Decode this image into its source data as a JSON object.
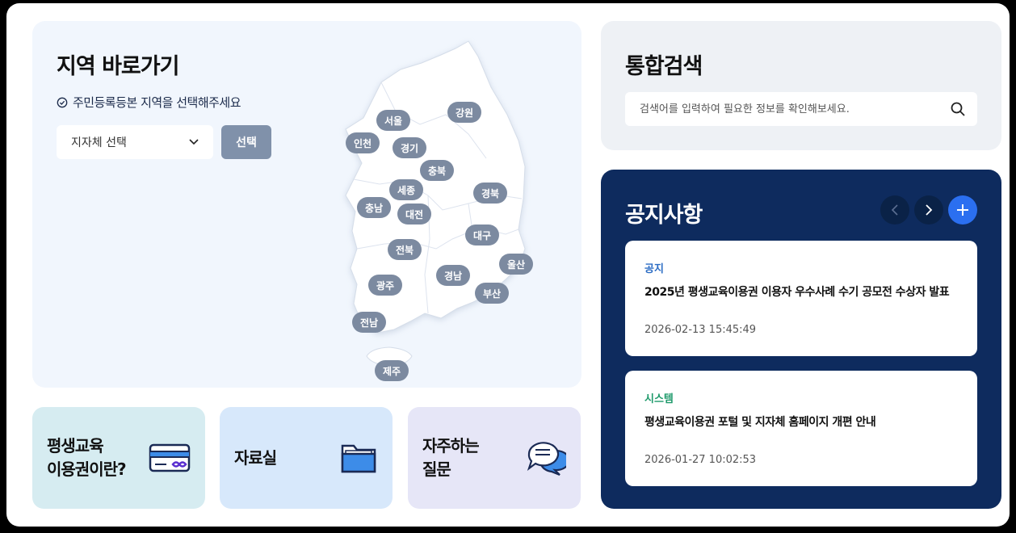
{
  "region": {
    "title": "지역 바로가기",
    "hint": "주민등록등본 지역을 선택해주세요",
    "select_value": "지자체 선택",
    "select_button": "선택",
    "pins": [
      "서울",
      "강원",
      "인천",
      "경기",
      "충북",
      "세종",
      "경북",
      "충남",
      "대전",
      "대구",
      "전북",
      "울산",
      "경남",
      "광주",
      "부산",
      "전남",
      "제주"
    ]
  },
  "quick_links": [
    {
      "label": "평생교육\n이용권이란?",
      "icon": "card-icon"
    },
    {
      "label": "자료실",
      "icon": "folder-icon"
    },
    {
      "label": "자주하는\n질문",
      "icon": "chat-bubbles-icon"
    }
  ],
  "search": {
    "title": "통합검색",
    "placeholder": "검색어를 입력하여 필요한 정보를 확인해보세요."
  },
  "notice": {
    "title": "공지사항",
    "items": [
      {
        "category": "공지",
        "category_color": "#2b6cc4",
        "title": "2025년 평생교육이용권 이용자 우수사례 수기 공모전 수상자 발표",
        "date": "2026-02-13 15:45:49"
      },
      {
        "category": "시스템",
        "category_color": "#1f9a6b",
        "title": "평생교육이용권 포털 및 지자체 홈페이지 개편 안내",
        "date": "2026-01-27 10:02:53"
      }
    ]
  },
  "colors": {
    "notice_bg": "#0e2b5e",
    "accent": "#2b6ff0",
    "pin": "#7c8aa0"
  }
}
